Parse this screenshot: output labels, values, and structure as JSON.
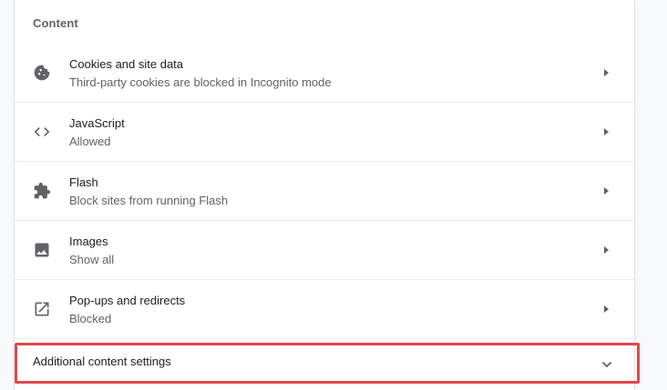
{
  "section": {
    "title": "Content"
  },
  "items": [
    {
      "label": "Cookies and site data",
      "sub": "Third-party cookies are blocked in Incognito mode",
      "icon": "cookie-icon"
    },
    {
      "label": "JavaScript",
      "sub": "Allowed",
      "icon": "code-brackets-icon"
    },
    {
      "label": "Flash",
      "sub": "Block sites from running Flash",
      "icon": "puzzle-piece-icon"
    },
    {
      "label": "Images",
      "sub": "Show all",
      "icon": "image-icon"
    },
    {
      "label": "Pop-ups and redirects",
      "sub": "Blocked",
      "icon": "open-in-new-icon"
    }
  ],
  "additional": {
    "label": "Additional content settings",
    "icon": "chevron-down-icon"
  },
  "colors": {
    "highlight_border": "#e2474a",
    "icon": "#5f6368",
    "text_primary": "#202124",
    "text_secondary": "#5f6368"
  }
}
